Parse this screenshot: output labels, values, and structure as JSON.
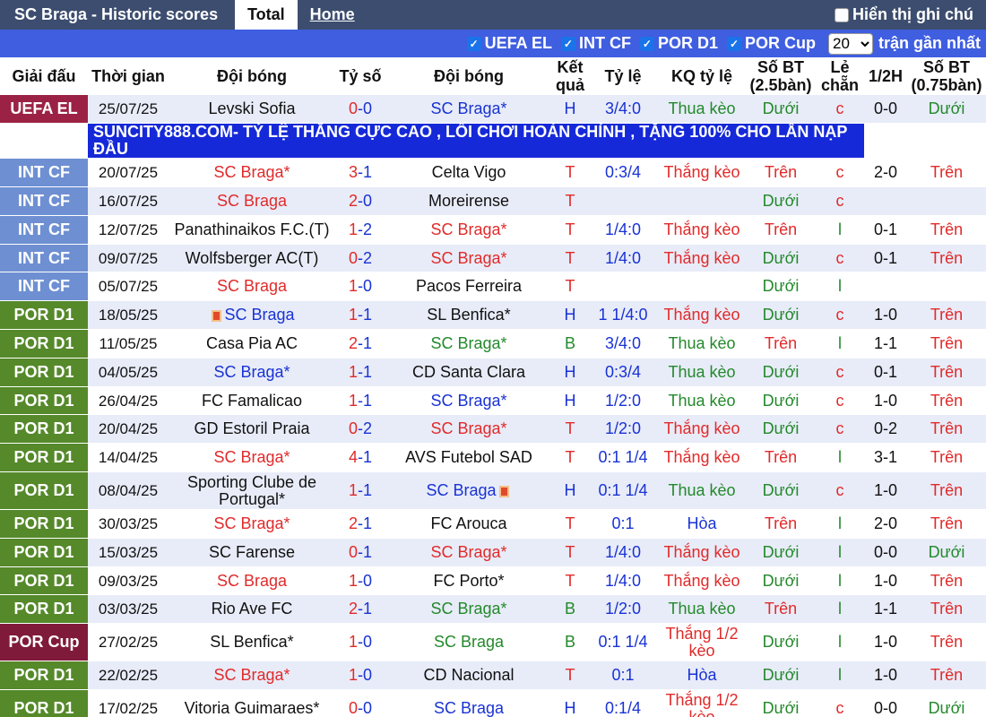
{
  "header": {
    "title": "SC Braga - Historic scores",
    "tab_total": "Total",
    "tab_home": "Home",
    "show_note": "Hiển thị ghi chú"
  },
  "filters": {
    "items": [
      "UEFA EL",
      "INT CF",
      "POR D1",
      "POR Cup"
    ],
    "count": "20",
    "count_label": "trận gần nhất"
  },
  "columns": [
    "Giải đấu",
    "Thời gian",
    "Đội bóng",
    "Tỷ số",
    "Đội bóng",
    "Kết quả",
    "Tỷ lệ",
    "KQ tỷ lệ",
    "Số BT (2.5bàn)",
    "Lẻ chẵn",
    "1/2H",
    "Số BT (0.75bàn)"
  ],
  "ad_text": "SUNCITY888.COM- TỶ LỆ THẮNG CỰC CAO , LỐI CHƠI HOÀN CHỈNH , TẶNG 100% CHO LẦN NẠP ĐẦU",
  "rows": [
    {
      "league": "UEFA EL",
      "lc": "el",
      "date": "25/07/25",
      "home": "Levski Sofia",
      "hc": "dark",
      "s1": "0",
      "s2": "0",
      "away": "SC Braga*",
      "ac": "blue",
      "res": "H",
      "odds": "3/4:0",
      "kq": "Thua kèo",
      "over": "Dưới",
      "oe": "c",
      "half": "0-0",
      "over2": "Dưới"
    },
    {
      "ad": true
    },
    {
      "league": "INT CF",
      "lc": "cf",
      "date": "20/07/25",
      "home": "SC Braga*",
      "hc": "red",
      "s1": "3",
      "s2": "1",
      "away": "Celta Vigo",
      "ac": "dark",
      "res": "T",
      "odds": "0:3/4",
      "kq": "Thắng kèo",
      "over": "Trên",
      "oe": "c",
      "half": "2-0",
      "over2": "Trên"
    },
    {
      "league": "INT CF",
      "lc": "cf",
      "date": "16/07/25",
      "home": "SC Braga",
      "hc": "red",
      "s1": "2",
      "s2": "0",
      "away": "Moreirense",
      "ac": "dark",
      "res": "T",
      "odds": "",
      "kq": "",
      "over": "Dưới",
      "oe": "c",
      "half": "",
      "over2": ""
    },
    {
      "league": "INT CF",
      "lc": "cf",
      "date": "12/07/25",
      "home": "Panathinaikos F.C.(T)",
      "hc": "dark",
      "s1": "1",
      "s2": "2",
      "away": "SC Braga*",
      "ac": "red",
      "res": "T",
      "odds": "1/4:0",
      "kq": "Thắng kèo",
      "over": "Trên",
      "oe": "l",
      "half": "0-1",
      "over2": "Trên"
    },
    {
      "league": "INT CF",
      "lc": "cf",
      "date": "09/07/25",
      "home": "Wolfsberger AC(T)",
      "hc": "dark",
      "s1": "0",
      "s2": "2",
      "away": "SC Braga*",
      "ac": "red",
      "res": "T",
      "odds": "1/4:0",
      "kq": "Thắng kèo",
      "over": "Dưới",
      "oe": "c",
      "half": "0-1",
      "over2": "Trên"
    },
    {
      "league": "INT CF",
      "lc": "cf",
      "date": "05/07/25",
      "home": "SC Braga",
      "hc": "red",
      "s1": "1",
      "s2": "0",
      "away": "Pacos Ferreira",
      "ac": "dark",
      "res": "T",
      "odds": "",
      "kq": "",
      "over": "Dưới",
      "oe": "l",
      "half": "",
      "over2": ""
    },
    {
      "league": "POR D1",
      "lc": "d1",
      "date": "18/05/25",
      "home": "SC Braga",
      "hc": "blue",
      "hflag": true,
      "s1": "1",
      "s2": "1",
      "away": "SL Benfica*",
      "ac": "dark",
      "res": "H",
      "odds": "1 1/4:0",
      "kq": "Thắng kèo",
      "over": "Dưới",
      "oe": "c",
      "half": "1-0",
      "over2": "Trên"
    },
    {
      "league": "POR D1",
      "lc": "d1",
      "date": "11/05/25",
      "home": "Casa Pia AC",
      "hc": "dark",
      "s1": "2",
      "s2": "1",
      "away": "SC Braga*",
      "ac": "green",
      "res": "B",
      "odds": "3/4:0",
      "kq": "Thua kèo",
      "over": "Trên",
      "oe": "l",
      "half": "1-1",
      "over2": "Trên"
    },
    {
      "league": "POR D1",
      "lc": "d1",
      "date": "04/05/25",
      "home": "SC Braga*",
      "hc": "blue",
      "s1": "1",
      "s2": "1",
      "away": "CD Santa Clara",
      "ac": "dark",
      "res": "H",
      "odds": "0:3/4",
      "kq": "Thua kèo",
      "over": "Dưới",
      "oe": "c",
      "half": "0-1",
      "over2": "Trên"
    },
    {
      "league": "POR D1",
      "lc": "d1",
      "date": "26/04/25",
      "home": "FC Famalicao",
      "hc": "dark",
      "s1": "1",
      "s2": "1",
      "away": "SC Braga*",
      "ac": "blue",
      "res": "H",
      "odds": "1/2:0",
      "kq": "Thua kèo",
      "over": "Dưới",
      "oe": "c",
      "half": "1-0",
      "over2": "Trên"
    },
    {
      "league": "POR D1",
      "lc": "d1",
      "date": "20/04/25",
      "home": "GD Estoril Praia",
      "hc": "dark",
      "s1": "0",
      "s2": "2",
      "away": "SC Braga*",
      "ac": "red",
      "res": "T",
      "odds": "1/2:0",
      "kq": "Thắng kèo",
      "over": "Dưới",
      "oe": "c",
      "half": "0-2",
      "over2": "Trên"
    },
    {
      "league": "POR D1",
      "lc": "d1",
      "date": "14/04/25",
      "home": "SC Braga*",
      "hc": "red",
      "s1": "4",
      "s2": "1",
      "away": "AVS Futebol SAD",
      "ac": "dark",
      "res": "T",
      "odds": "0:1 1/4",
      "kq": "Thắng kèo",
      "over": "Trên",
      "oe": "l",
      "half": "3-1",
      "over2": "Trên"
    },
    {
      "league": "POR D1",
      "lc": "d1",
      "tall": true,
      "date": "08/04/25",
      "home": "Sporting Clube de Portugal*",
      "hc": "dark",
      "s1": "1",
      "s2": "1",
      "away": "SC Braga",
      "ac": "blue",
      "aflag": true,
      "res": "H",
      "odds": "0:1 1/4",
      "kq": "Thua kèo",
      "over": "Dưới",
      "oe": "c",
      "half": "1-0",
      "over2": "Trên"
    },
    {
      "league": "POR D1",
      "lc": "d1",
      "date": "30/03/25",
      "home": "SC Braga*",
      "hc": "red",
      "s1": "2",
      "s2": "1",
      "away": "FC Arouca",
      "ac": "dark",
      "res": "T",
      "odds": "0:1",
      "kq": "Hòa",
      "over": "Trên",
      "oe": "l",
      "half": "2-0",
      "over2": "Trên"
    },
    {
      "league": "POR D1",
      "lc": "d1",
      "date": "15/03/25",
      "home": "SC Farense",
      "hc": "dark",
      "s1": "0",
      "s2": "1",
      "away": "SC Braga*",
      "ac": "red",
      "res": "T",
      "odds": "1/4:0",
      "kq": "Thắng kèo",
      "over": "Dưới",
      "oe": "l",
      "half": "0-0",
      "over2": "Dưới"
    },
    {
      "league": "POR D1",
      "lc": "d1",
      "date": "09/03/25",
      "home": "SC Braga",
      "hc": "red",
      "s1": "1",
      "s2": "0",
      "away": "FC Porto*",
      "ac": "dark",
      "res": "T",
      "odds": "1/4:0",
      "kq": "Thắng kèo",
      "over": "Dưới",
      "oe": "l",
      "half": "1-0",
      "over2": "Trên"
    },
    {
      "league": "POR D1",
      "lc": "d1",
      "date": "03/03/25",
      "home": "Rio Ave FC",
      "hc": "dark",
      "s1": "2",
      "s2": "1",
      "away": "SC Braga*",
      "ac": "green",
      "res": "B",
      "odds": "1/2:0",
      "kq": "Thua kèo",
      "over": "Trên",
      "oe": "l",
      "half": "1-1",
      "over2": "Trên"
    },
    {
      "league": "POR Cup",
      "lc": "cup",
      "tall": true,
      "date": "27/02/25",
      "home": "SL Benfica*",
      "hc": "dark",
      "s1": "1",
      "s2": "0",
      "away": "SC Braga",
      "ac": "green",
      "res": "B",
      "odds": "0:1 1/4",
      "kq": "Thắng 1/2 kèo",
      "over": "Dưới",
      "oe": "l",
      "half": "1-0",
      "over2": "Trên"
    },
    {
      "league": "POR D1",
      "lc": "d1",
      "date": "22/02/25",
      "home": "SC Braga*",
      "hc": "red",
      "s1": "1",
      "s2": "0",
      "away": "CD Nacional",
      "ac": "dark",
      "res": "T",
      "odds": "0:1",
      "kq": "Hòa",
      "over": "Dưới",
      "oe": "l",
      "half": "1-0",
      "over2": "Trên"
    },
    {
      "league": "POR D1",
      "lc": "d1",
      "tall": true,
      "date": "17/02/25",
      "home": "Vitoria Guimaraes*",
      "hc": "dark",
      "s1": "0",
      "s2": "0",
      "away": "SC Braga",
      "ac": "blue",
      "res": "H",
      "odds": "0:1/4",
      "kq": "Thắng 1/2 kèo",
      "over": "Dưới",
      "oe": "c",
      "half": "0-0",
      "over2": "Dưới"
    }
  ]
}
